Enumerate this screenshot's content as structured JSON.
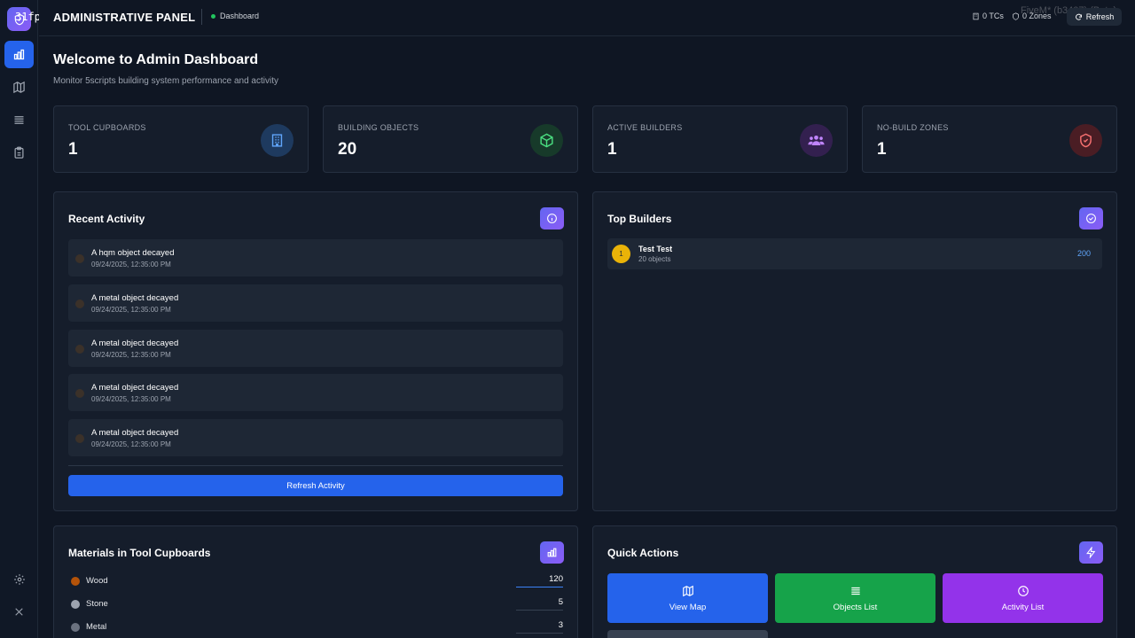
{
  "overlay": {
    "fps": "31fps",
    "watermark": "FiveM* (b3407) (Beta)"
  },
  "header": {
    "title": "ADMINISTRATIVE PANEL",
    "breadcrumb": "Dashboard",
    "tcs": "0 TCs",
    "zones": "0 Zones",
    "refresh_label": "Refresh"
  },
  "page": {
    "title": "Welcome to Admin Dashboard",
    "subtitle": "Monitor 5scripts building system performance and activity"
  },
  "stats": [
    {
      "label": "TOOL CUPBOARDS",
      "value": "1",
      "icon": "building-icon",
      "color": "#3b82f6"
    },
    {
      "label": "BUILDING OBJECTS",
      "value": "20",
      "icon": "cube-icon",
      "color": "#22c55e"
    },
    {
      "label": "ACTIVE BUILDERS",
      "value": "1",
      "icon": "users-icon",
      "color": "#a855f7"
    },
    {
      "label": "NO-BUILD ZONES",
      "value": "1",
      "icon": "shield-icon",
      "color": "#ef4444"
    }
  ],
  "recent_activity": {
    "title": "Recent Activity",
    "items": [
      {
        "text": "A hqm object decayed",
        "time": "09/24/2025, 12:35:00 PM"
      },
      {
        "text": "A metal object decayed",
        "time": "09/24/2025, 12:35:00 PM"
      },
      {
        "text": "A metal object decayed",
        "time": "09/24/2025, 12:35:00 PM"
      },
      {
        "text": "A metal object decayed",
        "time": "09/24/2025, 12:35:00 PM"
      },
      {
        "text": "A metal object decayed",
        "time": "09/24/2025, 12:35:00 PM"
      }
    ],
    "refresh_label": "Refresh Activity"
  },
  "top_builders": {
    "title": "Top Builders",
    "items": [
      {
        "rank": "1",
        "name": "Test Test",
        "sub": "20 objects",
        "count": "200"
      }
    ]
  },
  "materials": {
    "title": "Materials in Tool Cupboards",
    "items": [
      {
        "name": "Wood",
        "value": "120",
        "color": "#b45309"
      },
      {
        "name": "Stone",
        "value": "5",
        "color": "#9ca3af"
      },
      {
        "name": "Metal",
        "value": "3",
        "color": "#6b7280"
      }
    ]
  },
  "quick_actions": {
    "title": "Quick Actions",
    "items": [
      {
        "label": "View Map",
        "color": "#2563eb"
      },
      {
        "label": "Objects List",
        "color": "#16a34a"
      },
      {
        "label": "Activity List",
        "color": "#9333ea"
      }
    ]
  }
}
